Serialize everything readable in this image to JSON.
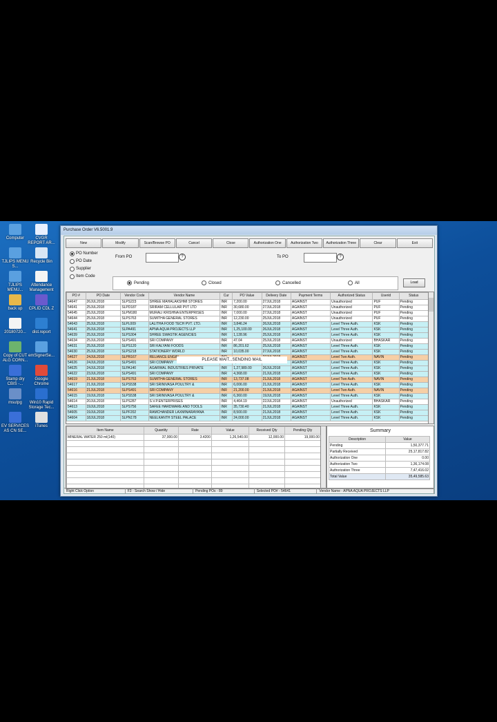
{
  "desktop_icons": [
    {
      "label": "Computer",
      "color": "#5aa0e0"
    },
    {
      "label": "CVGR REPORT AR...",
      "color": "#e8f0ff"
    },
    {
      "label": "TJLIPS MENU S...",
      "color": "#5aa0e0"
    },
    {
      "label": "Recycle Bin",
      "color": "#d8e6f4"
    },
    {
      "label": "TJLIPS MENU...",
      "color": "#5aa0e0"
    },
    {
      "label": "Attendance Management",
      "color": "#f4f4f4"
    },
    {
      "label": "back up",
      "color": "#e8b84a"
    },
    {
      "label": "CPLID CDL Z",
      "color": "#6a5acd"
    },
    {
      "label": "20180720...",
      "color": "#f4f4f4"
    },
    {
      "label": "dist.report",
      "color": "#2d7fd1"
    },
    {
      "label": "Copy of CUT ALG CORN...",
      "color": "#6db36d"
    },
    {
      "label": "emSignerSe...",
      "color": "#5aa0e0"
    },
    {
      "label": "Stamp dry CBIS -...",
      "color": "#3a6fd8"
    },
    {
      "label": "Google Chrome",
      "color": "#e04a3a"
    },
    {
      "label": "msutpg",
      "color": "#6a8fc8"
    },
    {
      "label": "Win10 Rapid Storage Tec...",
      "color": "#2a6fd0"
    },
    {
      "label": "EV SERVICES AS CN SE...",
      "color": "#3a6fd8"
    },
    {
      "label": "iTunes",
      "color": "#e0e0e0"
    }
  ],
  "window": {
    "title": "Purchase Order V6.5001.9"
  },
  "toolbar": [
    "New",
    "Modify",
    "Scan/Browse PO",
    "Cancel",
    "Close",
    "Authorization One",
    "Authorization Two",
    "Authorization Three",
    "Clear",
    "Exit"
  ],
  "search_by": [
    {
      "label": "PO Number",
      "selected": true
    },
    {
      "label": "PO Date",
      "selected": false
    },
    {
      "label": "Supplier",
      "selected": false
    },
    {
      "label": "Item Code",
      "selected": false
    }
  ],
  "range": {
    "from_label": "From PO",
    "to_label": "To PO",
    "from_value": "",
    "to_value": ""
  },
  "status_filter": [
    {
      "label": "Pending",
      "selected": true
    },
    {
      "label": "Closed",
      "selected": false
    },
    {
      "label": "Cancelled",
      "selected": false
    },
    {
      "label": "All",
      "selected": false
    }
  ],
  "load_label": "Load",
  "columns": [
    "PO #",
    "PO Date",
    "Vendor Code",
    "Vendor Name",
    "Cur",
    "PO Value",
    "Delivery Date",
    "Payment Terms",
    "Authorized Status",
    "Userid",
    "Status"
  ],
  "rows": [
    {
      "style": "w",
      "c": [
        "54647",
        "26JUL2018",
        "SLPS223",
        "SHREE MAHALAKSHMI STORES",
        "INR",
        "7,200.00",
        "27JUL2018",
        "AGAINST",
        "Unauthorized",
        "PUF",
        "Pending"
      ]
    },
    {
      "style": "w",
      "c": [
        "54641",
        "25JUL2018",
        "SLPD187",
        "SRIRAM CELLULAR PVT LTD",
        "INR",
        "30,680.00",
        "27JUL2018",
        "AGAINST",
        "Unauthorized",
        "PUF",
        "Pending"
      ]
    },
    {
      "style": "w",
      "c": [
        "54645",
        "25JUL2018",
        "SLPM180",
        "MURALI KRISHNA ENTERPRISES",
        "INR",
        "7,000.00",
        "27JUL2018",
        "AGAINST",
        "Unauthorized",
        "PUF",
        "Pending"
      ]
    },
    {
      "style": "w",
      "c": [
        "54644",
        "25JUL2018",
        "SLPS763",
        "SUMITHA GENERAL STORES",
        "INR",
        "12,230.00",
        "25JUL2018",
        "AGAINST",
        "Unauthorized",
        "PUF",
        "Pending"
      ]
    },
    {
      "style": "c",
      "c": [
        "54643",
        "25JUL2018",
        "SLPL009",
        "LALITHA FOOD TECH PVT. LTD.",
        "INR",
        "3,846.24",
        "26JUL2018",
        "AGAINST",
        "Level Three Auth.",
        "KSK",
        "Pending"
      ]
    },
    {
      "style": "c",
      "c": [
        "54641",
        "25JUL2018",
        "SLPA491",
        "APNA AQUA PROJECTS LLP",
        "INR",
        "1,25,100.00",
        "26JUL2018",
        "AGAINST",
        "Level Three Auth.",
        "KSK",
        "Pending"
      ]
    },
    {
      "style": "c",
      "c": [
        "54639",
        "25JUL2018",
        "SLPS304",
        "SHREE SWASTIK AGENCIES",
        "INR",
        "1,128.96",
        "25JUL2018",
        "AGAINST",
        "Level Three Auth.",
        "KSK",
        "Pending"
      ]
    },
    {
      "style": "w",
      "c": [
        "54634",
        "25JUL2018",
        "SLPS491",
        "SRI COMPANY",
        "INR",
        "47.04",
        "25JUL2018",
        "AGAINST",
        "Unauthorized",
        "BHASKAR",
        "Pending"
      ]
    },
    {
      "style": "c",
      "c": [
        "54631",
        "25JUL2018",
        "SLPS120",
        "SRI KALYANI FOODS",
        "INR",
        "86,201.62",
        "25JUL2018",
        "AGAINST",
        "Level Three Auth.",
        "KSK",
        "Pending"
      ]
    },
    {
      "style": "c",
      "c": [
        "54630",
        "25JUL2018",
        "SLPS218",
        "STATIONERY WORLD",
        "INR",
        "10,035.00",
        "27JUL2018",
        "AGAINST",
        "Level Three Auth.",
        "KSK",
        "Pending"
      ]
    },
    {
      "style": "o",
      "c": [
        "54627",
        "24JUL2018",
        "SLPR167",
        "RELIANCE ENGIN...",
        "INR",
        "",
        "27JUL2018",
        "AGAINST",
        "Level Two Auth.",
        "NAVIN",
        "Pending"
      ]
    },
    {
      "style": "c",
      "c": [
        "54626",
        "24JUL2018",
        "SLPS491",
        "SRI COMPANY",
        "INR",
        "1,31,067.62",
        "26JUL2018",
        "AGAINST",
        "Level Three Auth.",
        "KSK",
        "Pending"
      ]
    },
    {
      "style": "c",
      "c": [
        "54625",
        "24JUL2018",
        "SLPA140",
        "AGARWAL INDUSTRIES PRIVATE",
        "INR",
        "1,27,989.00",
        "26JUL2018",
        "AGAINST",
        "Level Three Auth.",
        "KSK",
        "Pending"
      ]
    },
    {
      "style": "c",
      "c": [
        "54622",
        "23JUL2018",
        "SLPS491",
        "SRI COMPANY",
        "INR",
        "4,368.00",
        "21JUL2018",
        "AGAINST",
        "Level Three Auth.",
        "KSK",
        "Pending"
      ]
    },
    {
      "style": "o",
      "c": [
        "54619",
        "21JUL2018",
        "SLPS763",
        "SUMITHA GENERAL STORES",
        "INR",
        "13,737.08",
        "21JUL2018",
        "AGAINST",
        "Level Two Auth.",
        "NAVIN",
        "Pending"
      ]
    },
    {
      "style": "c",
      "c": [
        "54617",
        "21JUL2018",
        "SLPS538",
        "SRI SRINIVASA POULTRY &",
        "INR",
        "6,006.00",
        "21JUL2018",
        "AGAINST",
        "Level Three Auth.",
        "KSK",
        "Pending"
      ]
    },
    {
      "style": "o",
      "c": [
        "54616",
        "21JUL2018",
        "SLPS491",
        "SRI COMPANY",
        "INR",
        "21,200.00",
        "21JUL2018",
        "AGAINST",
        "Level Two Auth.",
        "NAVIN",
        "Pending"
      ]
    },
    {
      "style": "c",
      "c": [
        "54615",
        "19JUL2018",
        "SLPS538",
        "SRI SRINIVASA POULTRY &",
        "INR",
        "6,360.00",
        "19JUL2018",
        "AGAINST",
        "Level Three Auth.",
        "KSK",
        "Pending"
      ]
    },
    {
      "style": "w",
      "c": [
        "54614",
        "20JUL2018",
        "SLPS287",
        "S.V.P.ENTERPRISES",
        "INR",
        "4,464.19",
        "22JUL2018",
        "AGAINST",
        "Unauthorized",
        "BHASKAR",
        "Pending"
      ]
    },
    {
      "style": "c",
      "c": [
        "54613",
        "19JUL2018",
        "SLPS756",
        "SAFEE HARDWARE AND TOOLS",
        "INR",
        "35,730.40",
        "21JUL2018",
        "AGAINST",
        "Level Three Auth.",
        "KSK",
        "Pending"
      ]
    },
    {
      "style": "c",
      "c": [
        "54605",
        "19JUL2018",
        "SLPF202",
        "RAMCHANDER LAXMINARAYANA",
        "INR",
        "8,500.00",
        "21JUL2018",
        "AGAINST",
        "Level Three Auth.",
        "KSK",
        "Pending"
      ]
    },
    {
      "style": "c",
      "c": [
        "54604",
        "18JUL2018",
        "SLPN178",
        "NEELKANTH STEEL PALACE",
        "INR",
        "24,000.00",
        "21JUL2018",
        "AGAINST",
        "Level Three Auth.",
        "KSK",
        "Pending"
      ]
    }
  ],
  "sending_message": "PLEASE WAIT...SENDING MAIL",
  "item_columns": [
    "Item Name",
    "Quantity",
    "Rate",
    "Value",
    "Received Qty",
    "Pending Qty"
  ],
  "item_rows": [
    {
      "c": [
        "MINERAL WATER 250 ml(140)",
        "37,000.00",
        "3.4200",
        "1,26,540.00",
        "12,000.00",
        "19,000.00"
      ]
    }
  ],
  "summary": {
    "title": "Summary",
    "columns": [
      "Description",
      "Value"
    ],
    "rows": [
      {
        "d": "Pending",
        "v": "1,50,377.71"
      },
      {
        "d": "Partially Received",
        "v": "25,17,817.82"
      },
      {
        "d": "Authorization One",
        "v": "0.00"
      },
      {
        "d": "Authorization Two",
        "v": "1,36,174.08"
      },
      {
        "d": "Authorization Three",
        "v": "7,47,416.02"
      },
      {
        "d": "Total Value",
        "v": "35,49,585.63"
      }
    ]
  },
  "statusbar": [
    "Right Click Option",
    "F3 - Search Show / Hide",
    "Pending POs - 89",
    "Selected PO# - 54641",
    "Vendor Name - APNA AQUA PROJECTS LLP"
  ]
}
